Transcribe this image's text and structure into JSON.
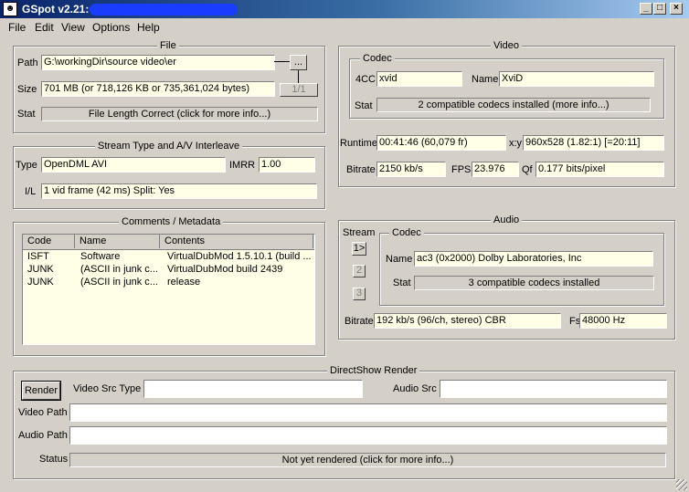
{
  "window": {
    "title": "GSpot v2.21:"
  },
  "menu": [
    "File",
    "Edit",
    "View",
    "Options",
    "Help"
  ],
  "file": {
    "legend": "File",
    "path_label": "Path",
    "path_value": "G:\\workingDir\\source video\\er",
    "browse_label": "...",
    "size_label": "Size",
    "size_value": "701 MB (or 718,126 KB or 735,361,024 bytes)",
    "counter_label": "1/1",
    "stat_label": "Stat",
    "stat_value": "File Length Correct (click for more info...)"
  },
  "stream_type": {
    "legend": "Stream Type and A/V Interleave",
    "type_label": "Type",
    "type_value": "OpenDML AVI",
    "imrr_label": "IMRR",
    "imrr_value": "1.00",
    "il_label": "I/L",
    "il_value": "1 vid frame (42 ms)  Split: Yes"
  },
  "comments": {
    "legend": "Comments / Metadata",
    "headers": [
      "Code",
      "Name",
      "Contents"
    ],
    "rows": [
      {
        "code": "ISFT",
        "name": "Software",
        "contents": "VirtualDubMod 1.5.10.1 (build ..."
      },
      {
        "code": "JUNK",
        "name": "(ASCII in junk c...",
        "contents": "VirtualDubMod build 2439"
      },
      {
        "code": "JUNK",
        "name": "(ASCII in junk c...",
        "contents": "release"
      }
    ]
  },
  "video": {
    "legend": "Video",
    "codec_legend": "Codec",
    "fourcc_label": "4CC",
    "fourcc_value": "xvid",
    "name_label": "Name",
    "name_value": "XviD",
    "stat_label": "Stat",
    "stat_value": "2 compatible codecs installed (more info...)",
    "runtime_label": "Runtime",
    "runtime_value": "00:41:46 (60,079 fr)",
    "xy_label": "x:y",
    "xy_value": "960x528 (1.82:1) [=20:11]",
    "bitrate_label": "Bitrate",
    "bitrate_value": "2150 kb/s",
    "fps_label": "FPS",
    "fps_value": "23.976",
    "qf_label": "Qf",
    "qf_value": "0.177 bits/pixel"
  },
  "audio": {
    "legend": "Audio",
    "stream_label": "Stream",
    "streams": [
      "1>",
      "2",
      "3"
    ],
    "codec_legend": "Codec",
    "name_label": "Name",
    "name_value": "ac3 (0x2000) Dolby Laboratories, Inc",
    "stat_label": "Stat",
    "stat_value": "3 compatible codecs installed",
    "bitrate_label": "Bitrate",
    "bitrate_value": "192 kb/s (96/ch, stereo) CBR",
    "fs_label": "Fs",
    "fs_value": "48000 Hz"
  },
  "directshow": {
    "legend": "DirectShow Render",
    "render_label": "Render",
    "video_src_type_label": "Video Src Type",
    "video_src_type_value": "",
    "audio_src_label": "Audio Src",
    "audio_src_value": "",
    "video_path_label": "Video Path",
    "video_path_value": "",
    "audio_path_label": "Audio Path",
    "audio_path_value": "",
    "status_label": "Status",
    "status_value": "Not yet rendered (click for more info...)"
  }
}
